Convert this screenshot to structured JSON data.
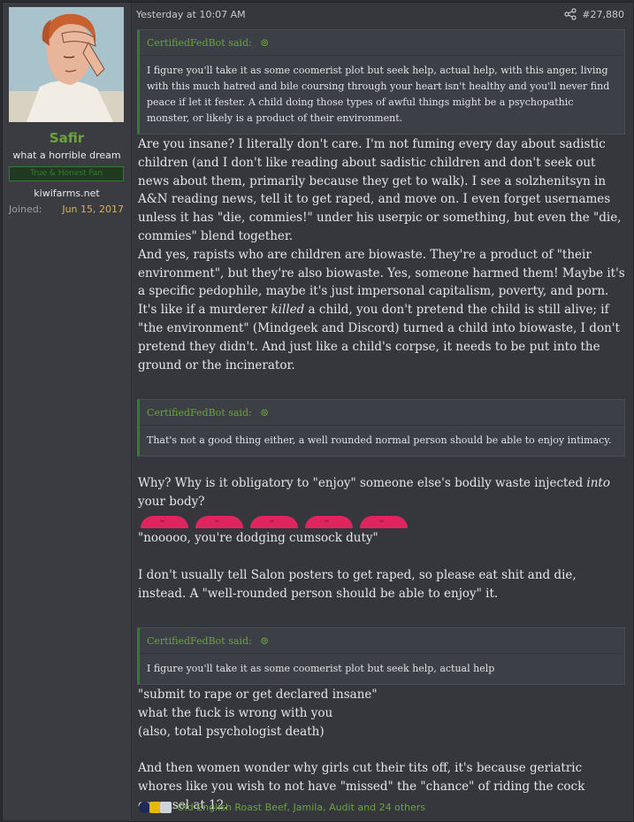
{
  "user": {
    "name": "Safir",
    "title": "what a horrible dream",
    "banner": "True & Honest Fan",
    "location": "kiwifarms.net",
    "joined_label": "Joined:",
    "joined_value": "Jun 15, 2017"
  },
  "post": {
    "time": "Yesterday at 10:07 AM",
    "number": "#27,880"
  },
  "quotes": [
    {
      "author": "CertifiedFedBot said:",
      "text": "I figure you'll take it as some coomerist plot but seek help, actual help, with this anger, living with this much hatred and bile coursing through your heart isn't healthy and you'll never find peace if let it fester. A child doing those types of awful things might be a psychopathic monster, or likely is a product of their environment."
    },
    {
      "author": "CertifiedFedBot said:",
      "text": "That's not a good thing either, a well rounded normal person should be able to enjoy intimacy."
    },
    {
      "author": "CertifiedFedBot said:",
      "text": "I figure you'll take it as some coomerist plot but seek help, actual help"
    }
  ],
  "body": {
    "p1": "Are you insane? I literally don't care. I'm not fuming every day about sadistic children (and I don't like reading about sadistic children and don't seek out news about them, primarily because they get to walk). I see a solzhenitsyn in A&N reading news, tell it to get raped, and move on. I even forget usernames unless it has \"die, commies!\" under his userpic or something, but even the \"die, commies\" blend together.",
    "p2a": "And yes, rapists who are children are biowaste. They're a product of \"their environment\", but they're also biowaste. Yes, someone harmed them! Maybe it's a specific pedophile, maybe it's just impersonal capitalism, poverty, and porn. It's like if a murderer ",
    "p2_em": "killed",
    "p2b": " a child, you don't pretend the child is still alive; if \"the environment\" (Mindgeek and Discord) turned a child into biowaste, I don't pretend they didn't. And just like a child's corpse, it needs to be put into the ground or the incinerator.",
    "p3a": "Why? Why is it obligatory to \"enjoy\" someone else's bodily waste injected ",
    "p3_em": "into",
    "p3b": " your body?",
    "p4": "\"nooooo, you're dodging cumsock duty\"",
    "p5": "I don't usually tell Salon posters to get raped, so please eat shit and die, instead. A \"well-rounded person should be able to enjoy\" it.",
    "p6": "\"submit to rape or get declared insane\"",
    "p7": "what the fuck is wrong with you",
    "p8": "(also, total psychologist death)",
    "p9": "And then women wonder why girls cut their tits off, it's because geriatric whores like you wish to not have \"missed\" the \"chance\" of riding the cock carousel at 12."
  },
  "reactions": {
    "text": "Old English Roast Beef, Jamila, Audit and 24 others"
  },
  "icons": {
    "share": "share-icon",
    "quote_up": "arrow-up-circle-icon"
  }
}
